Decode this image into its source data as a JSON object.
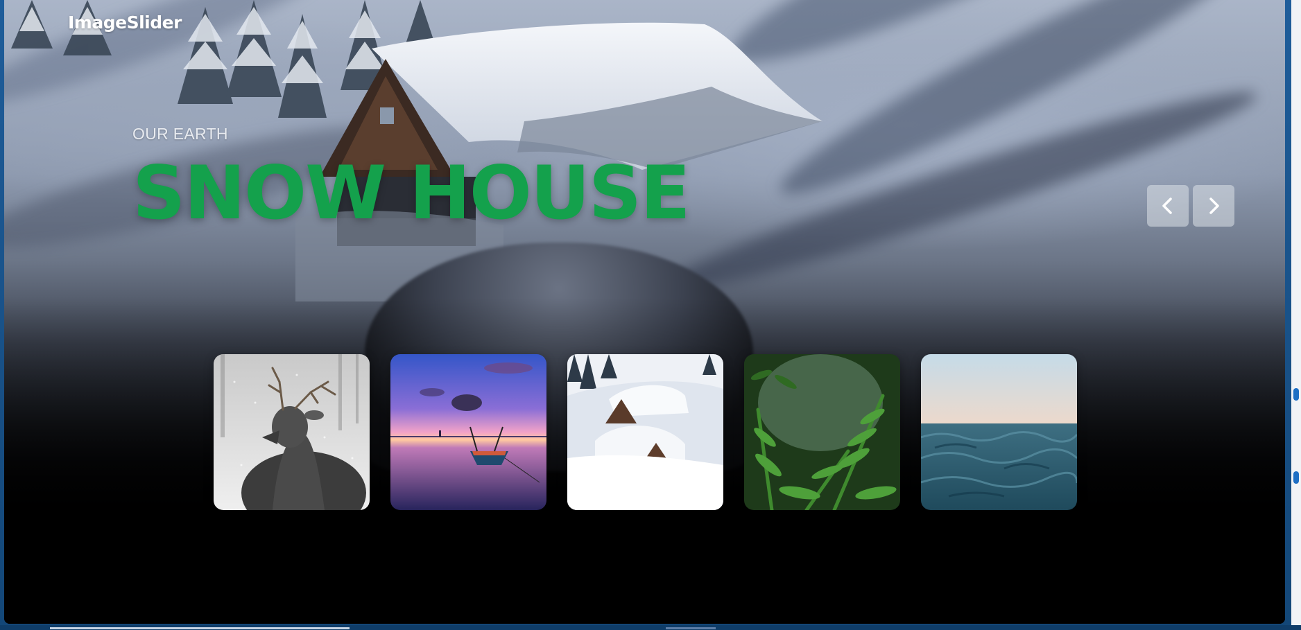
{
  "app": {
    "logo": "ImageSlider"
  },
  "hero": {
    "subtitle": "OUR EARTH",
    "title": "SNOW HOUSE",
    "title_color": "#14a14c"
  },
  "navigation": {
    "prev_icon": "chevron-left-icon",
    "next_icon": "chevron-right-icon"
  },
  "thumbnails": [
    {
      "name": "deer",
      "subject": "deer in snowy forest"
    },
    {
      "name": "boat",
      "subject": "boat on lake at sunset"
    },
    {
      "name": "snow-house",
      "subject": "snow-covered cabins"
    },
    {
      "name": "fern",
      "subject": "ferns in misty forest"
    },
    {
      "name": "ocean",
      "subject": "ocean waves"
    }
  ]
}
